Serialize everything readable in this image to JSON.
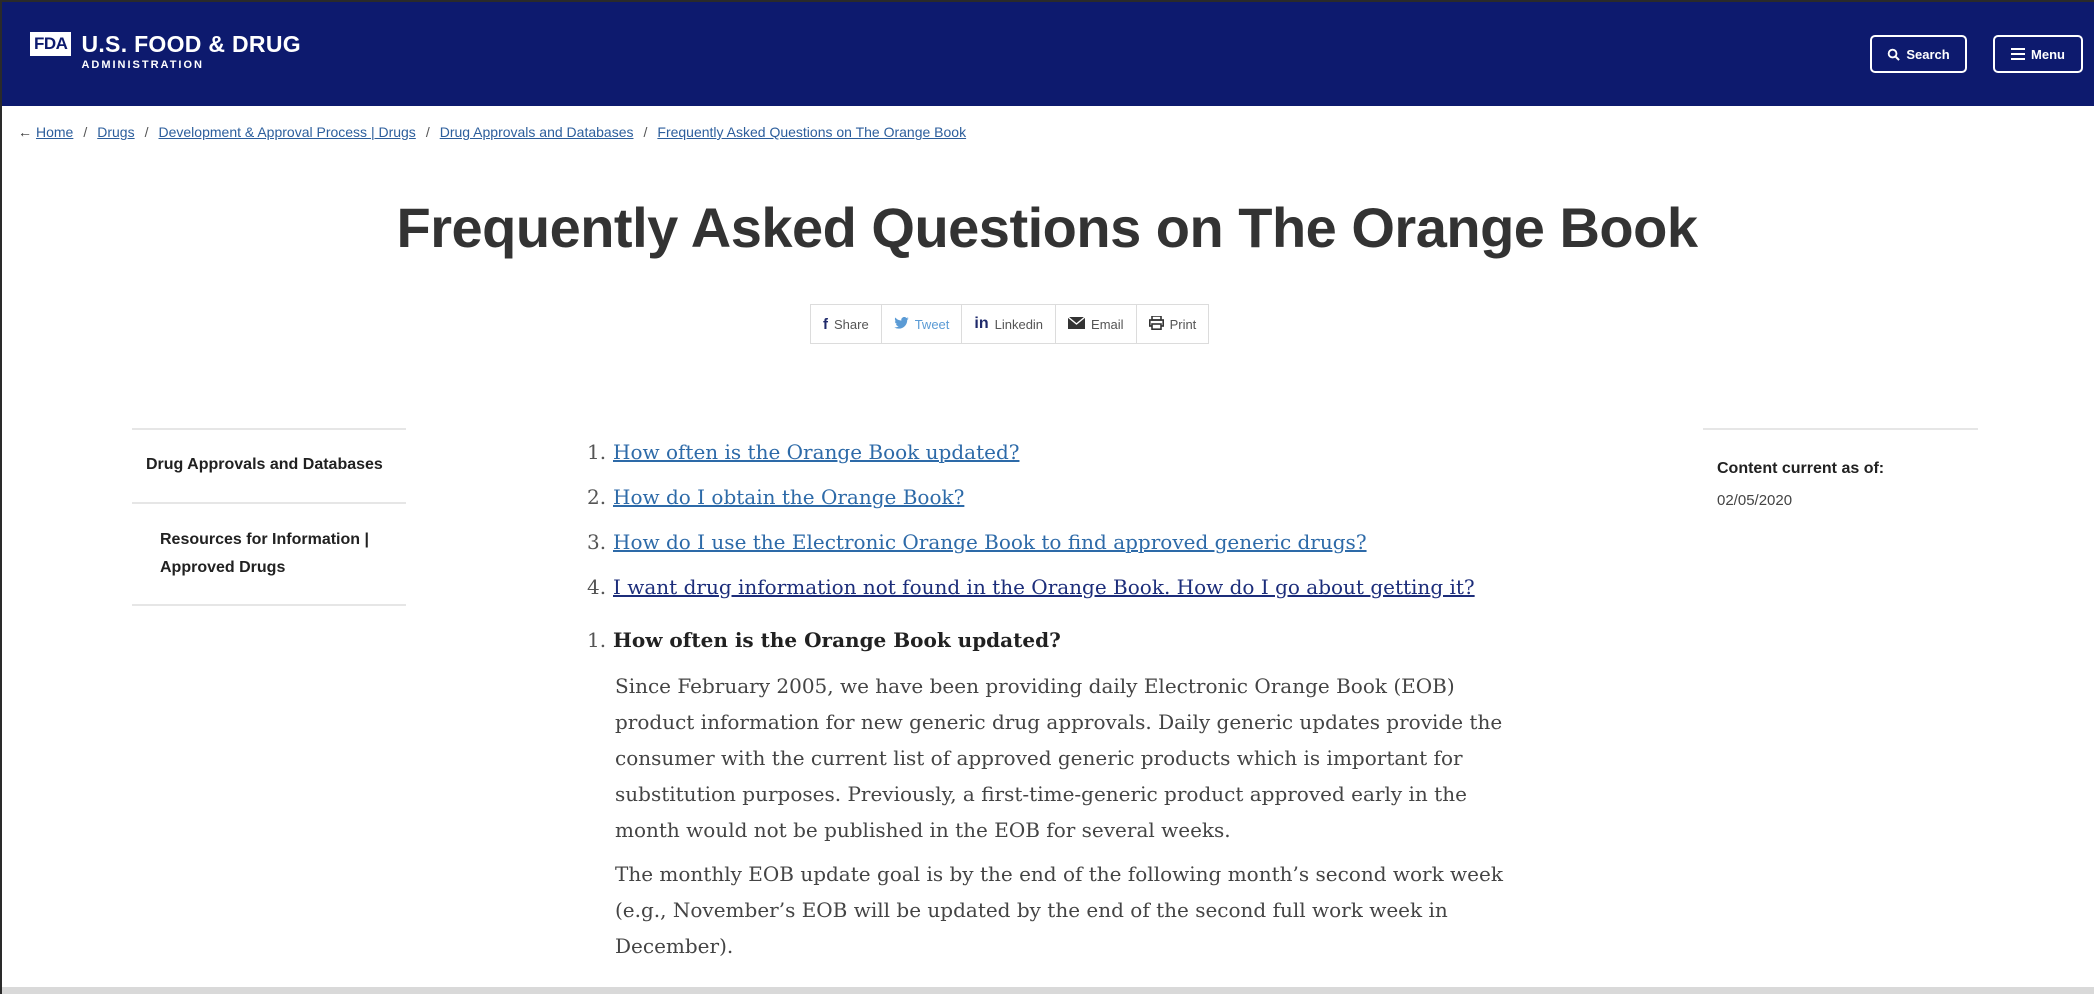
{
  "header": {
    "logo_badge": "FDA",
    "logo_line1": "U.S. FOOD & DRUG",
    "logo_line2": "ADMINISTRATION",
    "search_label": "Search",
    "menu_label": "Menu",
    "background_color": "#0d1a6e"
  },
  "breadcrumb": {
    "back_arrow": "←",
    "items": [
      "Home",
      "Drugs",
      "Development & Approval Process | Drugs",
      "Drug Approvals and Databases",
      "Frequently Asked Questions on The Orange Book"
    ],
    "separator": "/"
  },
  "page_title": "Frequently Asked Questions on The Orange Book",
  "share": {
    "items": [
      {
        "icon": "f",
        "label": "Share"
      },
      {
        "icon": "tweet-bird",
        "label": "Tweet"
      },
      {
        "icon": "in",
        "label": "Linkedin"
      },
      {
        "icon": "envelope",
        "label": "Email"
      },
      {
        "icon": "printer",
        "label": "Print"
      }
    ]
  },
  "left_nav": {
    "items": [
      "Drug Approvals and Databases",
      "Resources for Information | Approved Drugs"
    ]
  },
  "faq": {
    "questions": [
      {
        "num": "1.",
        "text": "How often is the Orange Book updated?"
      },
      {
        "num": "2.",
        "text": "How do I obtain the Orange Book?"
      },
      {
        "num": "3.",
        "text": "How do I use the Electronic Orange Book to find approved generic drugs?"
      },
      {
        "num": "4.",
        "text": "I want drug information not found in the Orange Book. How do I go about getting it?"
      }
    ],
    "section_num": "1.",
    "section_heading": "How often is the Orange Book updated?",
    "paragraphs": [
      "Since February 2005, we have been providing daily Electronic Orange Book (EOB) product information for new generic drug approvals.  Daily generic updates provide the consumer with the current list of approved generic products which is important for substitution purposes.  Previously, a first-time-generic product approved early in the month would not be published in the EOB for several weeks.",
      "The monthly EOB update goal is by the end of the following month’s second work week (e.g., November’s EOB will be updated by the end of the second full work week in December)."
    ]
  },
  "sidebar": {
    "label": "Content current as of:",
    "date": "02/05/2020"
  }
}
